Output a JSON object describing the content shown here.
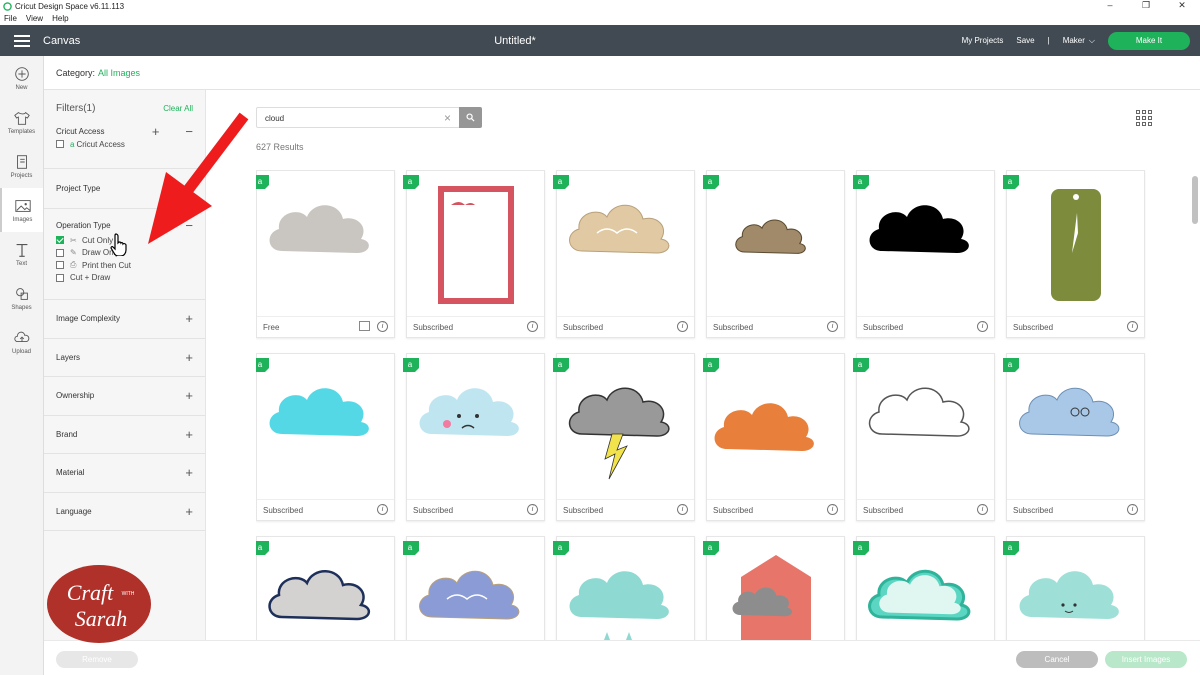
{
  "window": {
    "title": "Cricut Design Space  v6.11.113"
  },
  "menu": [
    "File",
    "View",
    "Help"
  ],
  "header": {
    "canvas": "Canvas",
    "doc_title": "Untitled*",
    "my_projects": "My Projects",
    "save": "Save",
    "divider": "|",
    "machine": "Maker",
    "make_it": "Make It"
  },
  "rail": [
    "New",
    "Templates",
    "Projects",
    "Images",
    "Text",
    "Shapes",
    "Upload"
  ],
  "category": {
    "label": "Category:",
    "value": "All Images"
  },
  "filters": {
    "title": "Filters(1)",
    "clear_all": "Clear All",
    "cricut_access": {
      "title": "Cricut Access",
      "option": "Cricut Access"
    },
    "project_type": "Project Type",
    "operation_type": {
      "title": "Operation Type",
      "options": [
        "Cut Only",
        "Draw Only",
        "Print then Cut",
        "Cut + Draw"
      ]
    },
    "sections": [
      "Image Complexity",
      "Layers",
      "Ownership",
      "Brand",
      "Material",
      "Language"
    ]
  },
  "search": {
    "value": "cloud",
    "results": "627 Results"
  },
  "cards": [
    {
      "label": "Free",
      "shape": "cloud",
      "color": "#c9c5c0"
    },
    {
      "label": "Subscribed",
      "shape": "frame",
      "color": "#d5545f"
    },
    {
      "label": "Subscribed",
      "shape": "cloud-sketch",
      "color": "#e0c9a3"
    },
    {
      "label": "Subscribed",
      "shape": "cloud-small",
      "color": "#a08a6a"
    },
    {
      "label": "Subscribed",
      "shape": "cloud",
      "color": "#000000"
    },
    {
      "label": "Subscribed",
      "shape": "tag",
      "color": "#7d8c3c"
    },
    {
      "label": "Subscribed",
      "shape": "cloud",
      "color": "#54d8e6"
    },
    {
      "label": "Subscribed",
      "shape": "cloud-face",
      "color": "#bfe6f0"
    },
    {
      "label": "Subscribed",
      "shape": "storm",
      "color": "#999999"
    },
    {
      "label": "Subscribed",
      "shape": "clouds-low",
      "color": "#e87f3a"
    },
    {
      "label": "Subscribed",
      "shape": "cloud-outline",
      "color": "#555555"
    },
    {
      "label": "Subscribed",
      "shape": "cloud-glasses",
      "color": "#a9c8e8"
    },
    {
      "label": "",
      "shape": "cloud-bubble",
      "color": "#d3d2d0"
    },
    {
      "label": "",
      "shape": "cloud-sketch",
      "color": "#8b9bd6"
    },
    {
      "label": "",
      "shape": "cloud-rain",
      "color": "#8ed9d2"
    },
    {
      "label": "",
      "shape": "house",
      "color": "#e8756a"
    },
    {
      "label": "",
      "shape": "cloud-glow",
      "color": "#5bd6c2"
    },
    {
      "label": "",
      "shape": "cloud-smile",
      "color": "#9ee0d8"
    }
  ],
  "footer": {
    "remove": "Remove",
    "cancel": "Cancel",
    "insert": "Insert Images"
  },
  "watermark": {
    "line1": "Craft",
    "with": "WITH",
    "line2": "Sarah"
  },
  "colors": {
    "green": "#1eb25b",
    "header": "#414a52",
    "arrow": "#ee1c1c"
  }
}
